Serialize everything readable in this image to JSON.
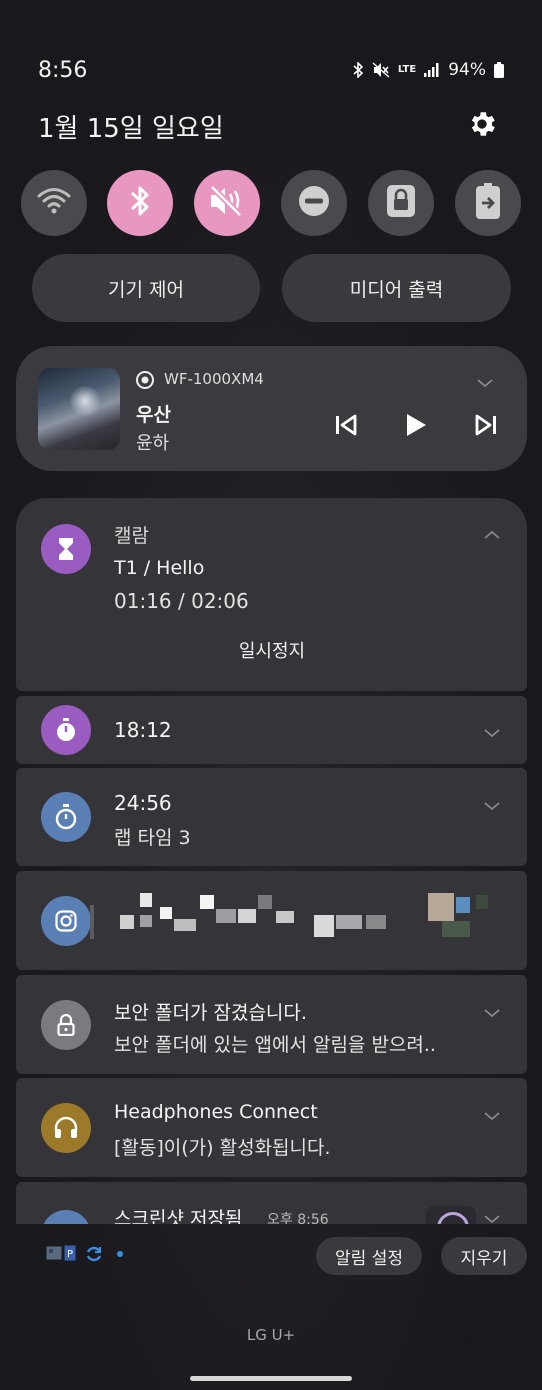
{
  "status_bar": {
    "time": "8:56",
    "network": "LTE",
    "battery": "94%"
  },
  "header": {
    "date": "1월 15일 일요일"
  },
  "quick_settings": {
    "toggles": [
      {
        "name": "wifi",
        "on": false
      },
      {
        "name": "bluetooth",
        "on": true
      },
      {
        "name": "mute",
        "on": true
      },
      {
        "name": "do-not-disturb",
        "on": false
      },
      {
        "name": "secure-folder",
        "on": false
      },
      {
        "name": "power-saving",
        "on": false
      }
    ],
    "device_control_label": "기기 제어",
    "media_output_label": "미디어 출력"
  },
  "media": {
    "device": "WF-1000XM4",
    "title": "우산",
    "artist": "윤하"
  },
  "notifications": {
    "timer": {
      "app": "캘람",
      "title": "T1 / Hello",
      "progress": "01:16 / 02:06",
      "action": "일시정지"
    },
    "stopwatch1": {
      "time": "18:12"
    },
    "stopwatch2": {
      "time": "24:56",
      "lap": "랩 타임 3"
    },
    "secure": {
      "title": "보안 폴더가 잠겼습니다.",
      "body": "보안 폴더에 있는 앱에서 알림을 받으려.."
    },
    "headphones": {
      "title": "Headphones Connect",
      "body": "[활동]이(가) 활성화됩니다."
    },
    "screenshot": {
      "title": "스크린샷 저장됨",
      "time": "오후 8:56"
    }
  },
  "bottom": {
    "notification_settings": "알림 설정",
    "clear": "지우기",
    "carrier": "LG U+"
  },
  "colors": {
    "toggle_on": "#e897c1",
    "toggle_off": "#4a4a4e",
    "timer_icon": "#9a5cc0",
    "stopwatch_icon": "#5a7fb5",
    "instagram_icon": "#5a7fb5",
    "secure_icon": "#7a7a80",
    "headphones_icon": "#9c7a2a"
  }
}
